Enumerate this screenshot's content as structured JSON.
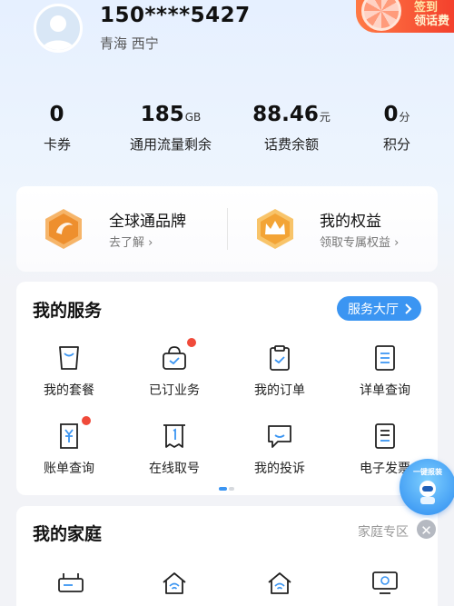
{
  "user": {
    "phone": "150****5427",
    "location": "青海 西宁"
  },
  "promo": {
    "line1": "签到",
    "line2": "领话费"
  },
  "stats": [
    {
      "value": "0",
      "unit": "",
      "label": "卡券"
    },
    {
      "value": "185",
      "unit": "GB",
      "label": "通用流量剩余"
    },
    {
      "value": "88.46",
      "unit": "元",
      "label": "话费余额"
    },
    {
      "value": "0",
      "unit": "分",
      "label": "积分"
    }
  ],
  "benefits": [
    {
      "title": "全球通品牌",
      "sub": "去了解 ›",
      "icon": "globe-brand-icon"
    },
    {
      "title": "我的权益",
      "sub": "领取专属权益 ›",
      "icon": "crown-icon"
    }
  ],
  "services": {
    "title": "我的服务",
    "hall_button": "服务大厅",
    "items": [
      {
        "label": "我的套餐",
        "icon": "bag-icon",
        "dot": false
      },
      {
        "label": "已订业务",
        "icon": "basket-icon",
        "dot": true
      },
      {
        "label": "我的订单",
        "icon": "clipboard-icon",
        "dot": false
      },
      {
        "label": "详单查询",
        "icon": "list-icon",
        "dot": false
      },
      {
        "label": "账单查询",
        "icon": "bill-icon",
        "dot": true
      },
      {
        "label": "在线取号",
        "icon": "ticket-icon",
        "dot": false
      },
      {
        "label": "我的投诉",
        "icon": "chat-icon",
        "dot": false
      },
      {
        "label": "电子发票",
        "icon": "invoice-icon",
        "dot": false
      }
    ]
  },
  "family": {
    "title": "我的家庭",
    "link": "家庭专区"
  },
  "float": {
    "report_label": "一键报装"
  },
  "colors": {
    "accent": "#3b95f2",
    "badge_orange": "#f5a44a",
    "dot_red": "#f04a3a"
  }
}
